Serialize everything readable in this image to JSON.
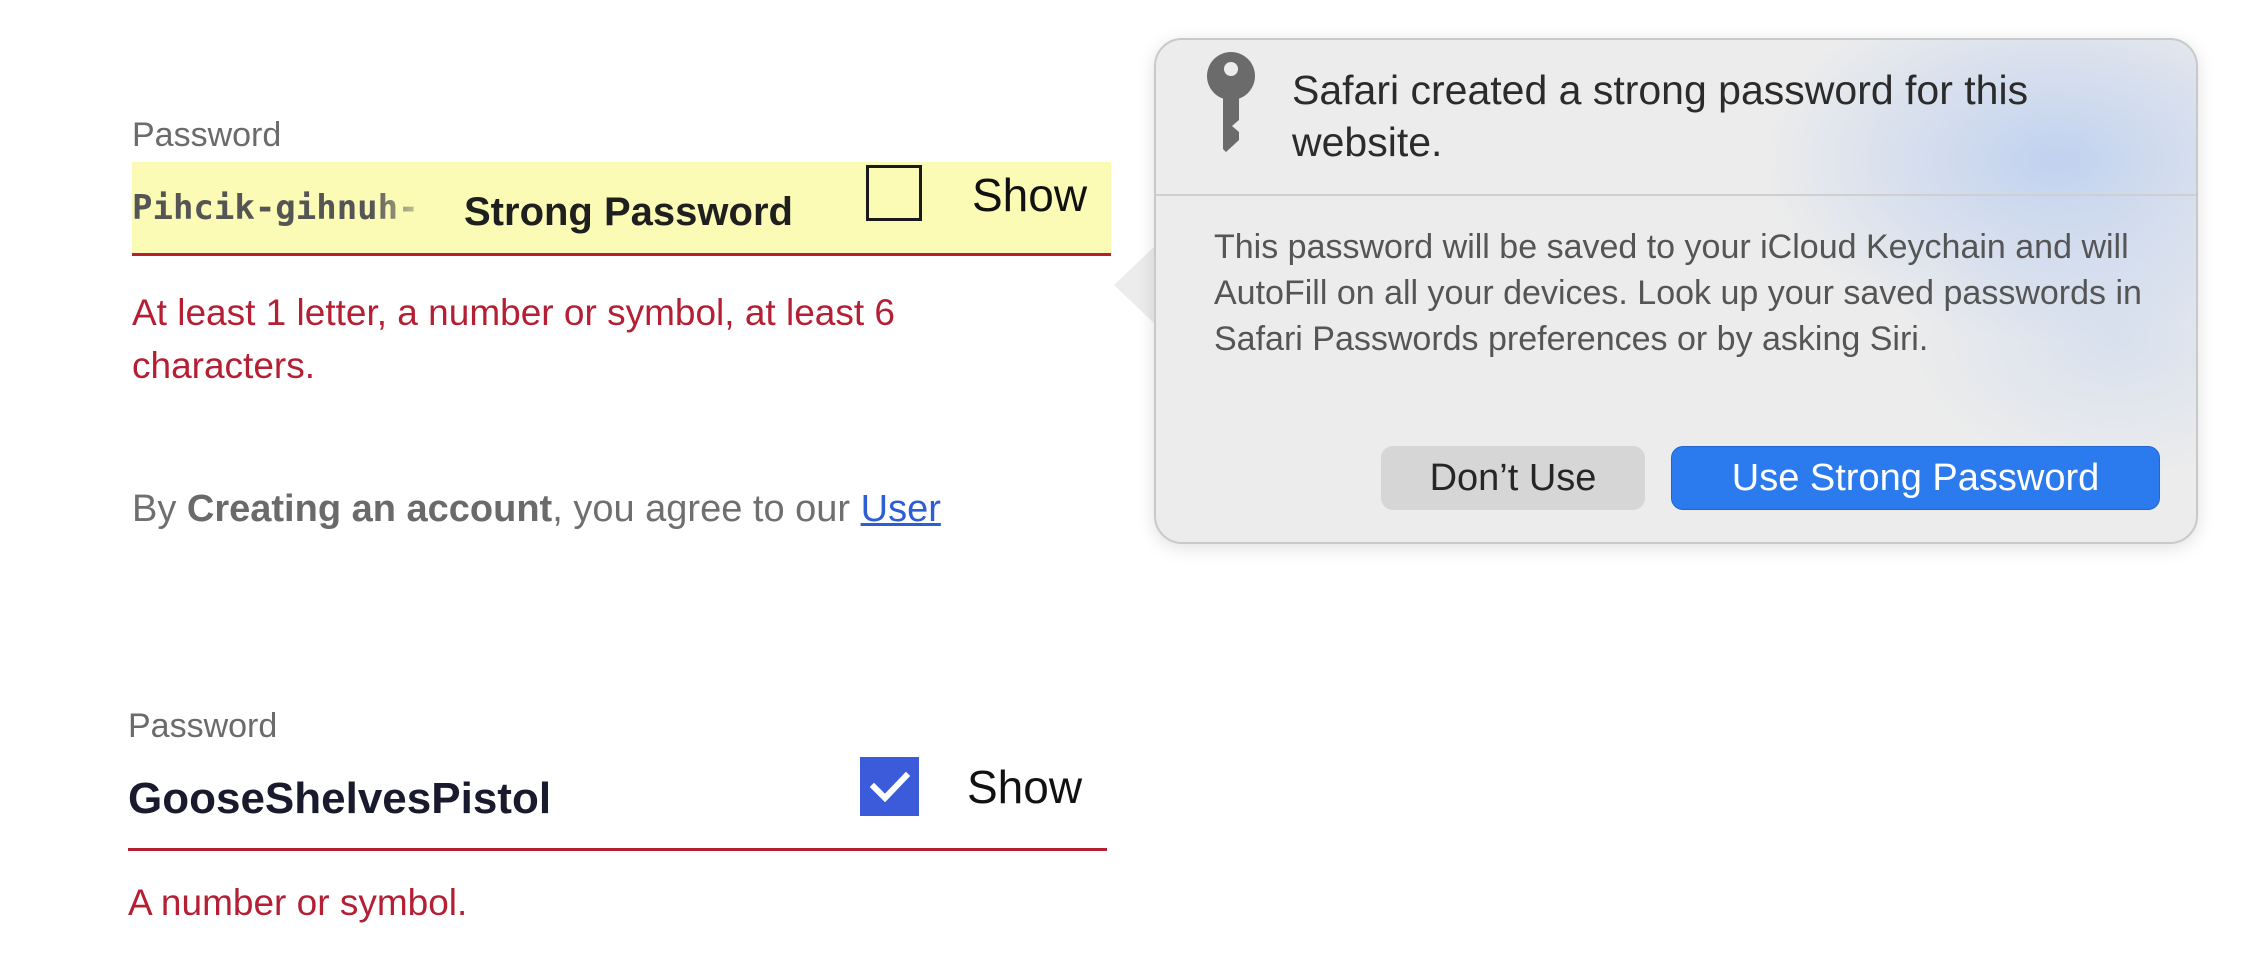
{
  "form_top": {
    "password_label": "Password",
    "password_value": "Pihcik-gihnuh-",
    "strong_password_tag": "Strong Password",
    "show_label": "Show",
    "show_checked": false,
    "error_message": "At least 1 letter, a number or symbol, at least 6 characters.",
    "terms": {
      "prefix": "By ",
      "bold": "Creating an account",
      "middle": ", you agree to our ",
      "link": "User"
    }
  },
  "popover": {
    "title": "Safari created a strong password for this website.",
    "body": "This password will be saved to your iCloud Keychain and will AutoFill on all your devices. Look up your saved passwords in Safari Passwords preferences or by asking Siri.",
    "dont_use_label": "Don’t Use",
    "use_strong_label": "Use Strong Password",
    "icon": "key-icon",
    "primary_color": "#2b7bef"
  },
  "form_bottom": {
    "password_label": "Password",
    "password_value": "GooseShelvesPistol",
    "show_label": "Show",
    "show_checked": true,
    "error_message": "A number or symbol."
  },
  "colors": {
    "error": "#b51f34",
    "autofill_background": "#fbfbb5",
    "checkbox_checked": "#3b5bdb",
    "link": "#2c5ed6"
  }
}
